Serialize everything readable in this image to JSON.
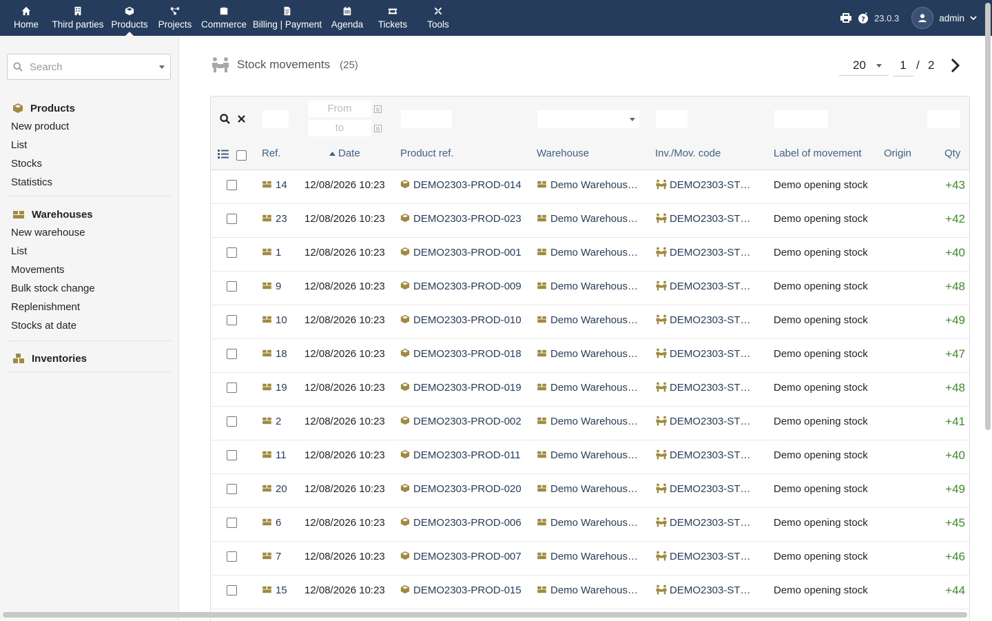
{
  "topnav": {
    "items": [
      {
        "label": "Home",
        "icon": "home-icon"
      },
      {
        "label": "Third parties",
        "icon": "building-icon"
      },
      {
        "label": "Products",
        "icon": "cube-icon"
      },
      {
        "label": "Projects",
        "icon": "project-icon"
      },
      {
        "label": "Commerce",
        "icon": "suitcase-icon"
      },
      {
        "label": "Billing | Payment",
        "icon": "invoice-icon"
      },
      {
        "label": "Agenda",
        "icon": "calendar-icon"
      },
      {
        "label": "Tickets",
        "icon": "ticket-icon"
      },
      {
        "label": "Tools",
        "icon": "tools-icon"
      }
    ],
    "active": "Products",
    "version": "23.0.3",
    "user": "admin"
  },
  "sidebar": {
    "search_placeholder": "Search",
    "products": {
      "title": "Products",
      "links": [
        "New product",
        "List",
        "Stocks",
        "Statistics"
      ]
    },
    "warehouses": {
      "title": "Warehouses",
      "links": [
        "New warehouse",
        "List",
        "Movements",
        "Bulk stock change",
        "Replenishment",
        "Stocks at date"
      ]
    },
    "inventories": {
      "title": "Inventories"
    }
  },
  "main": {
    "title": "Stock movements",
    "count": "(25)",
    "limit": "20",
    "page_current": "1",
    "page_sep": "/",
    "page_total": "2",
    "filters": {
      "date_from": "From",
      "date_to": "to"
    },
    "columns": {
      "ref": "Ref.",
      "date": "Date",
      "product_ref": "Product ref.",
      "warehouse": "Warehouse",
      "inv_code": "Inv./Mov. code",
      "label": "Label of movement",
      "origin": "Origin",
      "qty": "Qty"
    },
    "rows": [
      {
        "ref": "14",
        "date": "12/08/2026 10:23",
        "product": "DEMO2303-PROD-014",
        "warehouse": "Demo Warehous…",
        "code": "DEMO2303-ST…",
        "label": "Demo opening stock",
        "origin": "",
        "qty": "+43"
      },
      {
        "ref": "23",
        "date": "12/08/2026 10:23",
        "product": "DEMO2303-PROD-023",
        "warehouse": "Demo Warehous…",
        "code": "DEMO2303-ST…",
        "label": "Demo opening stock",
        "origin": "",
        "qty": "+42"
      },
      {
        "ref": "1",
        "date": "12/08/2026 10:23",
        "product": "DEMO2303-PROD-001",
        "warehouse": "Demo Warehous…",
        "code": "DEMO2303-ST…",
        "label": "Demo opening stock",
        "origin": "",
        "qty": "+40"
      },
      {
        "ref": "9",
        "date": "12/08/2026 10:23",
        "product": "DEMO2303-PROD-009",
        "warehouse": "Demo Warehous…",
        "code": "DEMO2303-ST…",
        "label": "Demo opening stock",
        "origin": "",
        "qty": "+48"
      },
      {
        "ref": "10",
        "date": "12/08/2026 10:23",
        "product": "DEMO2303-PROD-010",
        "warehouse": "Demo Warehous…",
        "code": "DEMO2303-ST…",
        "label": "Demo opening stock",
        "origin": "",
        "qty": "+49"
      },
      {
        "ref": "18",
        "date": "12/08/2026 10:23",
        "product": "DEMO2303-PROD-018",
        "warehouse": "Demo Warehous…",
        "code": "DEMO2303-ST…",
        "label": "Demo opening stock",
        "origin": "",
        "qty": "+47"
      },
      {
        "ref": "19",
        "date": "12/08/2026 10:23",
        "product": "DEMO2303-PROD-019",
        "warehouse": "Demo Warehous…",
        "code": "DEMO2303-ST…",
        "label": "Demo opening stock",
        "origin": "",
        "qty": "+48"
      },
      {
        "ref": "2",
        "date": "12/08/2026 10:23",
        "product": "DEMO2303-PROD-002",
        "warehouse": "Demo Warehous…",
        "code": "DEMO2303-ST…",
        "label": "Demo opening stock",
        "origin": "",
        "qty": "+41"
      },
      {
        "ref": "11",
        "date": "12/08/2026 10:23",
        "product": "DEMO2303-PROD-011",
        "warehouse": "Demo Warehous…",
        "code": "DEMO2303-ST…",
        "label": "Demo opening stock",
        "origin": "",
        "qty": "+40"
      },
      {
        "ref": "20",
        "date": "12/08/2026 10:23",
        "product": "DEMO2303-PROD-020",
        "warehouse": "Demo Warehous…",
        "code": "DEMO2303-ST…",
        "label": "Demo opening stock",
        "origin": "",
        "qty": "+49"
      },
      {
        "ref": "6",
        "date": "12/08/2026 10:23",
        "product": "DEMO2303-PROD-006",
        "warehouse": "Demo Warehous…",
        "code": "DEMO2303-ST…",
        "label": "Demo opening stock",
        "origin": "",
        "qty": "+45"
      },
      {
        "ref": "7",
        "date": "12/08/2026 10:23",
        "product": "DEMO2303-PROD-007",
        "warehouse": "Demo Warehous…",
        "code": "DEMO2303-ST…",
        "label": "Demo opening stock",
        "origin": "",
        "qty": "+46"
      },
      {
        "ref": "15",
        "date": "12/08/2026 10:23",
        "product": "DEMO2303-PROD-015",
        "warehouse": "Demo Warehous…",
        "code": "DEMO2303-ST…",
        "label": "Demo opening stock",
        "origin": "",
        "qty": "+44"
      }
    ]
  },
  "colors": {
    "topbar": "#263c5c",
    "link": "#263c5c",
    "header_text": "#3f5f86",
    "qty_positive": "#3d8b28",
    "module_icon": "#a08a3d"
  }
}
